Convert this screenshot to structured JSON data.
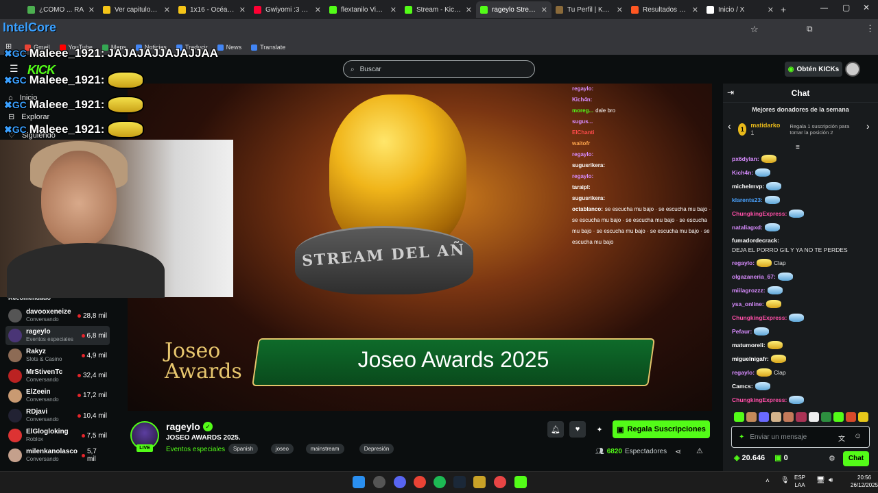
{
  "browser": {
    "tabs": [
      {
        "label": "¿CÓMO ... RA",
        "color": "#4caf50"
      },
      {
        "label": "Ver capitulos sin ...",
        "color": "#f5c518"
      },
      {
        "label": "1x16 - Océanos d...",
        "color": "#f5c518"
      },
      {
        "label": "Gwiyomi :3 sub e...",
        "color": "#ff0033"
      },
      {
        "label": "flextanilo Videos",
        "color": "#53fc18"
      },
      {
        "label": "Stream - Kick Das...",
        "color": "#53fc18"
      },
      {
        "label": "rageylo Stream",
        "color": "#53fc18",
        "active": true
      },
      {
        "label": "Tu Perfil | Key-Dro...",
        "color": "#8a6a3a"
      },
      {
        "label": "Resultados de jos...",
        "color": "#ff5722"
      },
      {
        "label": "Inicio / X",
        "color": "#ffffff"
      }
    ],
    "bookmarks": [
      {
        "label": "Gmail",
        "color": "#ea4335"
      },
      {
        "label": "YouTube",
        "color": "#ff0000"
      },
      {
        "label": "Maps",
        "color": "#34a853"
      },
      {
        "label": "Noticias",
        "color": "#4285f4"
      },
      {
        "label": "Traducir",
        "color": "#4285f4"
      },
      {
        "label": "News",
        "color": "#4285f4"
      },
      {
        "label": "Translate",
        "color": "#4285f4"
      }
    ]
  },
  "overlay": {
    "brand": "IntelCore",
    "kick": "KICK",
    "messages": [
      {
        "user": "Maleee_1921:",
        "text": "JAJAJAJJAJAJJAA"
      },
      {
        "user": "Maleee_1921:",
        "text": ""
      },
      {
        "user": "Maleee_1921:",
        "text": ""
      },
      {
        "user": "Maleee_1921:",
        "text": ""
      }
    ]
  },
  "search": {
    "placeholder": "Buscar"
  },
  "header": {
    "get_kicks": "Obtén KICKs"
  },
  "sidebar": {
    "nav": [
      {
        "label": "Inicio",
        "icon": "home-icon"
      },
      {
        "label": "Explorar",
        "icon": "compass-icon"
      },
      {
        "label": "Siguiendo",
        "icon": "heart-icon"
      }
    ],
    "recommended_title": "Recomendado",
    "recommended": [
      {
        "name": "davooxeneize",
        "category": "Conversando",
        "viewers": "28,8 mil",
        "color": "#555"
      },
      {
        "name": "rageylo",
        "category": "Eventos especiales",
        "viewers": "6,8 mil",
        "color": "#4a3576",
        "selected": true
      },
      {
        "name": "Rakyz",
        "category": "Slots & Casino",
        "viewers": "4,9 mil",
        "color": "#8d6b55"
      },
      {
        "name": "MrStivenTc",
        "category": "Conversando",
        "viewers": "32,4 mil",
        "color": "#b22"
      },
      {
        "name": "ElZeein",
        "category": "Conversando",
        "viewers": "17,2 mil",
        "color": "#c99a72"
      },
      {
        "name": "RDjavi",
        "category": "Conversando",
        "viewers": "10,4 mil",
        "color": "#223"
      },
      {
        "name": "ElGlogloking",
        "category": "Roblox",
        "viewers": "7,5 mil",
        "color": "#d33"
      },
      {
        "name": "milenkanolasco",
        "category": "Conversando",
        "viewers": "5,7 mil",
        "color": "#c4a08c"
      }
    ]
  },
  "video": {
    "banner": "Joseo Awards 2025",
    "logo": "Joseo Awards",
    "trophy_text": "STREAM DEL AÑ",
    "overlay_chat": [
      {
        "user": "regaylo:",
        "text": "",
        "color": "#d88cff"
      },
      {
        "user": "Kich4n:",
        "text": "",
        "color": "#d88cff"
      },
      {
        "user": "moreg...",
        "text": "dale bro",
        "color": "#53fc18"
      },
      {
        "user": "sugus...",
        "text": "",
        "color": "#d88cff"
      },
      {
        "user": "ElChanti",
        "text": "",
        "color": "#ff4b4b"
      },
      {
        "user": "waitofr",
        "text": "",
        "color": "#ffa64d"
      },
      {
        "user": "regaylo:",
        "text": "",
        "color": "#d88cff"
      },
      {
        "user": "sugusrikera:",
        "text": "",
        "color": "#ffffff"
      },
      {
        "user": "regaylo:",
        "text": "",
        "color": "#d88cff"
      },
      {
        "user": "taraipl:",
        "text": "",
        "color": "#ffffff"
      },
      {
        "user": "sugusrikera:",
        "text": "",
        "color": "#ffffff"
      },
      {
        "user": "octablanco:",
        "text": "se escucha mu bajo · se escucha mu bajo · se escucha mu bajo · se escucha mu bajo · se escucha mu bajo · se escucha mu bajo · se escucha mu bajo · se escucha mu bajo",
        "color": "#ffffff"
      }
    ]
  },
  "channel": {
    "name": "rageylo",
    "title": "JOSEO AWARDS 2025.",
    "category": "Eventos especiales",
    "live": "LIVE",
    "tags": [
      "Spanish",
      "joseo",
      "mainstream",
      "Depresión"
    ],
    "gift_label": "Regala Suscripciones",
    "viewers_count": "6820",
    "viewers_label": "Espectadores"
  },
  "chat": {
    "title": "Chat",
    "donors_title": "Mejores donadores de la semana",
    "top_donor": {
      "rank": "1",
      "name": "matidarko",
      "amount": "1",
      "cta": "Regala 1 suscripción para tomar la posición 2"
    },
    "messages": [
      {
        "user": "px6dylan:",
        "text": "",
        "color": "#d88cff",
        "emote": "y"
      },
      {
        "user": "Kich4n:",
        "text": "",
        "color": "#d88cff",
        "emote": "b"
      },
      {
        "user": "michelmvp:",
        "text": "",
        "color": "#ffffff",
        "emote": "b"
      },
      {
        "user": "klarents23:",
        "text": "",
        "color": "#4aa3ff",
        "emote": "b"
      },
      {
        "user": "ChungkingExpress:",
        "text": "",
        "color": "#ff4fa8",
        "emote": "b"
      },
      {
        "user": "nataliagxd:",
        "text": "",
        "color": "#d88cff",
        "emote": "b"
      },
      {
        "user": "fumadordecrack:",
        "text": "DEJA EL PORRO GIL Y YA NO TE PERDES",
        "color": "#ffffff",
        "emote": ""
      },
      {
        "user": "regaylo:",
        "text": "Clap",
        "color": "#d88cff",
        "emote": "y"
      },
      {
        "user": "olgazaneria_67:",
        "text": "",
        "color": "#d88cff",
        "emote": "b"
      },
      {
        "user": "miilagrozzz:",
        "text": "",
        "color": "#d88cff",
        "emote": "b"
      },
      {
        "user": "ysa_online:",
        "text": "",
        "color": "#d88cff",
        "emote": "y"
      },
      {
        "user": "ChungkingExpress:",
        "text": "",
        "color": "#ff4fa8",
        "emote": "b"
      },
      {
        "user": "Pefaur:",
        "text": "",
        "color": "#d88cff",
        "emote": "b"
      },
      {
        "user": "matumoreli:",
        "text": "",
        "color": "#ffffff",
        "emote": "y"
      },
      {
        "user": "miguelnigafr:",
        "text": "",
        "color": "#ffffff",
        "emote": "y"
      },
      {
        "user": "regaylo:",
        "text": "Clap",
        "color": "#d88cff",
        "emote": "y"
      },
      {
        "user": "Camcs:",
        "text": "",
        "color": "#ffffff",
        "emote": "b"
      },
      {
        "user": "ChungkingExpress:",
        "text": "",
        "color": "#ff4fa8",
        "emote": "b"
      }
    ],
    "input_placeholder": "Enviar un mensaje",
    "points": "20.646",
    "second_count": "0",
    "send_label": "Chat"
  },
  "taskbar": {
    "lang": "ESP",
    "layout": "LAA",
    "time": "20:56",
    "date": "26/12/2025"
  },
  "colors": {
    "kick_green": "#53fc18",
    "bg": "#0b0e0f",
    "panel": "#181b1d"
  }
}
